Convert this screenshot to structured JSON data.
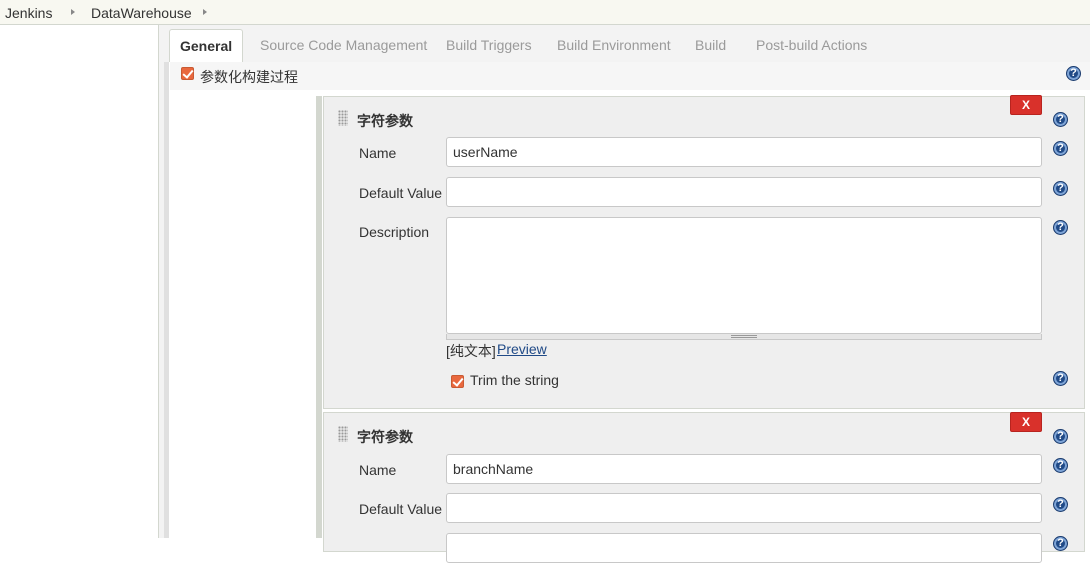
{
  "breadcrumb": {
    "items": [
      "Jenkins",
      "DataWarehouse"
    ]
  },
  "tabs": [
    {
      "label": "General",
      "active": true
    },
    {
      "label": "Source Code Management",
      "active": false
    },
    {
      "label": "Build Triggers",
      "active": false
    },
    {
      "label": "Build Environment",
      "active": false
    },
    {
      "label": "Build",
      "active": false
    },
    {
      "label": "Post-build Actions",
      "active": false
    }
  ],
  "general": {
    "parameterized_label": "参数化构建过程",
    "parameterized_checked": true
  },
  "params": [
    {
      "title": "字符参数",
      "delete_label": "X",
      "name_label": "Name",
      "name_value": "userName",
      "default_label": "Default Value",
      "default_value": "",
      "description_label": "Description",
      "description_value": "",
      "plaintext_label": "[纯文本]",
      "preview_label": "Preview",
      "trim_label": "Trim the string",
      "trim_checked": true
    },
    {
      "title": "字符参数",
      "delete_label": "X",
      "name_label": "Name",
      "name_value": "branchName",
      "default_label": "Default Value",
      "default_value": ""
    }
  ],
  "icons": {
    "help": "help-icon",
    "breadcrumb_separator": "chevron-right-icon",
    "drag_handle": "drag-handle-icon"
  },
  "colors": {
    "delete_button": "#d9312b",
    "checkbox": "#e9683e",
    "link": "#204a87",
    "help_icon": "#204a87"
  }
}
